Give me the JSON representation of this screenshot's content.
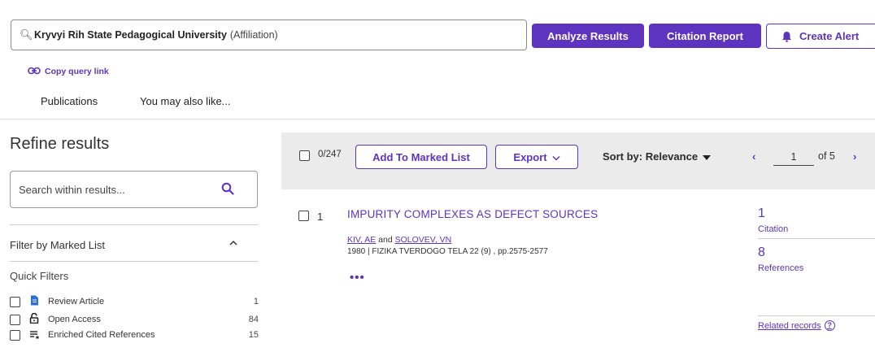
{
  "search": {
    "query_bold": "Kryvyi Rih State Pedagogical University",
    "query_field": "(Affiliation)"
  },
  "actions": {
    "analyze": "Analyze Results",
    "citation_report": "Citation Report",
    "create_alert": "Create Alert"
  },
  "copy_link": "Copy query link",
  "tabs": [
    {
      "label": "Publications"
    },
    {
      "label": "You may also like..."
    }
  ],
  "sidebar": {
    "title": "Refine results",
    "search_placeholder": "Search within results...",
    "filter_marked": "Filter by Marked List",
    "quick_filters_title": "Quick Filters",
    "quick_filters": [
      {
        "icon": "document-icon",
        "label": "Review Article",
        "count": "1"
      },
      {
        "icon": "lock-open-icon",
        "label": "Open Access",
        "count": "84"
      },
      {
        "icon": "enriched-list-icon",
        "label": "Enriched Cited References",
        "count": "15"
      }
    ]
  },
  "toolbar": {
    "selected": "0/247",
    "add_marked": "Add To Marked List",
    "export": "Export",
    "sort": "Sort by: Relevance",
    "page": "1",
    "of_pages": "of 5"
  },
  "record": {
    "index": "1",
    "title": "IMPURITY COMPLEXES AS DEFECT SOURCES",
    "author1": "KIV, AE",
    "and": "and",
    "author2": "SOLOVEV, VN",
    "source": "1980 | FIZIKA TVERDOGO TELA 22 (9) , pp.2575-2577",
    "more": "•••",
    "citations": "1",
    "citations_label": "Citation",
    "references": "8",
    "references_label": "References",
    "related": "Related records"
  },
  "colors": {
    "accent": "#5e33bf",
    "results_bg": "#ebebeb"
  }
}
